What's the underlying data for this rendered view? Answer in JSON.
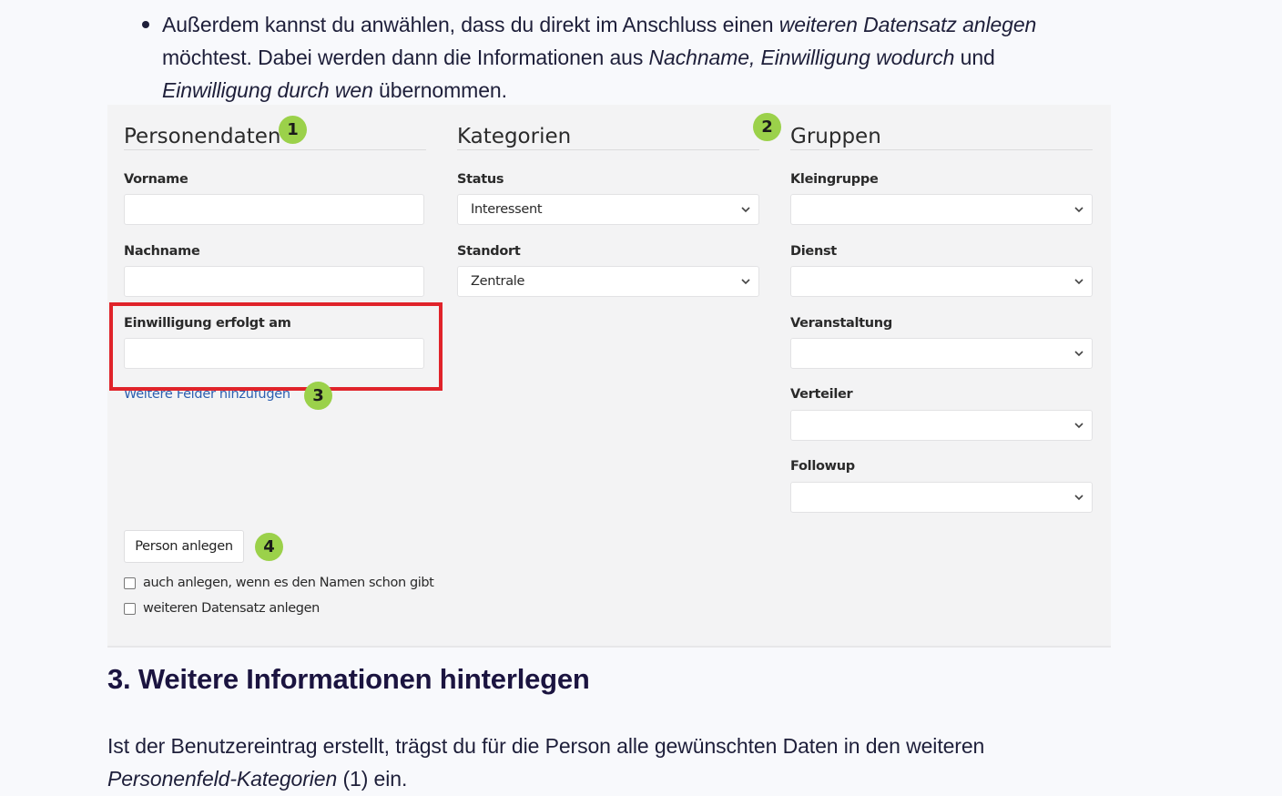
{
  "bullet": {
    "t1": "Außerdem kannst du anwählen, dass du direkt im Anschluss einen ",
    "t2": "weiteren Datensatz anlegen",
    "t3": " möchtest. Dabei werden dann die Informationen aus ",
    "t4": "Nachname, Einwilligung wodurch",
    "t5": " und ",
    "t6": "Einwilligung durch wen",
    "t7": " übernommen."
  },
  "screenshot": {
    "personendaten": {
      "title": "Personendaten",
      "badge": "1",
      "vorname_label": "Vorname",
      "vorname_value": "",
      "nachname_label": "Nachname",
      "nachname_value": "",
      "einwilligung_label": "Einwilligung erfolgt am",
      "einwilligung_value": "",
      "more_fields_link": "Weitere Felder hinzufügen",
      "badge3": "3"
    },
    "kategorien": {
      "title": "Kategorien",
      "badge": "2",
      "status_label": "Status",
      "status_value": "Interessent",
      "standort_label": "Standort",
      "standort_value": "Zentrale"
    },
    "gruppen": {
      "title": "Gruppen",
      "kleingruppe_label": "Kleingruppe",
      "dienst_label": "Dienst",
      "veranstaltung_label": "Veranstaltung",
      "verteiler_label": "Verteiler",
      "followup_label": "Followup"
    },
    "actions": {
      "submit_label": "Person anlegen",
      "badge4": "4",
      "checkbox1_label": "auch anlegen, wenn es den Namen schon gibt",
      "checkbox2_label": "weiteren Datensatz anlegen"
    }
  },
  "section": {
    "heading": "3. Weitere Informationen hinterlegen",
    "p1": "Ist der Benutzereintrag erstellt, trägst du für die Person alle gewünschten Daten in den weiteren ",
    "p2": "Personenfeld-Kategorien",
    "p3": " (1) ein."
  },
  "colors": {
    "badge": "#9bd14a",
    "highlight": "#e0232a",
    "link": "#2d5fb0",
    "heading": "#1b1440"
  }
}
